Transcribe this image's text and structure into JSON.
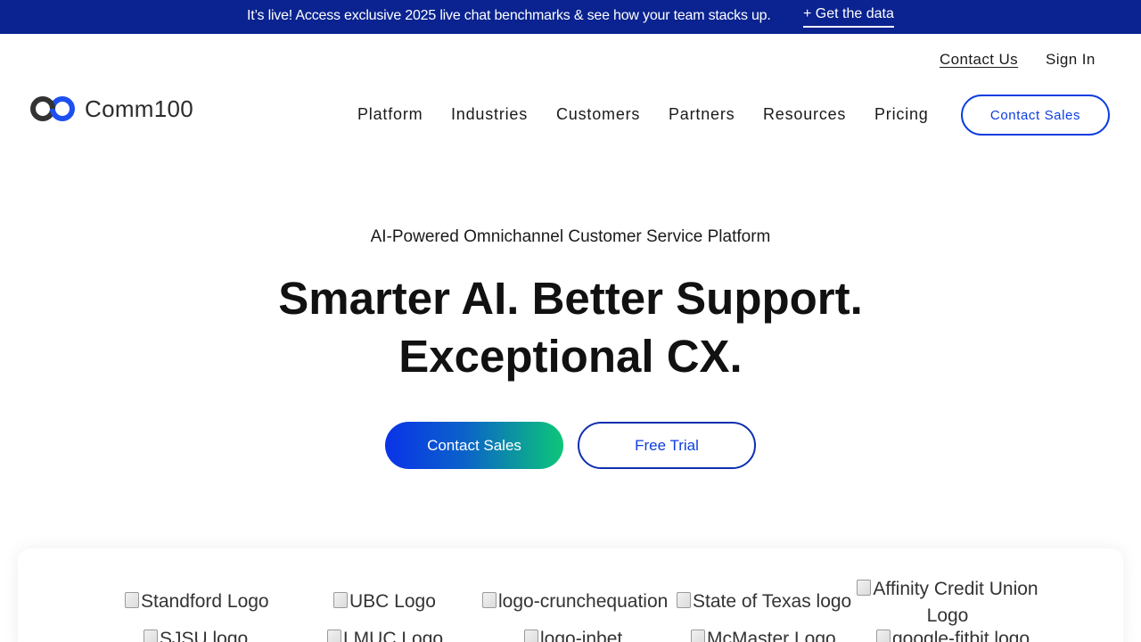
{
  "banner": {
    "message": "It’s live! Access exclusive 2025 live chat benchmarks & see how your team stacks up.",
    "link_label": "+ Get the data"
  },
  "utility_nav": {
    "contact_label": "Contact Us",
    "signin_label": "Sign In"
  },
  "logo": {
    "text": "Comm100"
  },
  "nav": {
    "items": [
      "Platform",
      "Industries",
      "Customers",
      "Partners",
      "Resources",
      "Pricing"
    ],
    "cta_label": "Contact Sales"
  },
  "hero": {
    "eyebrow": "AI-Powered Omnichannel Customer Service Platform",
    "title_line1": "Smarter AI. Better Support.",
    "title_line2": "Exceptional CX.",
    "primary_button": "Contact Sales",
    "secondary_button": "Free Trial"
  },
  "customer_logos": {
    "row1": [
      "Standford Logo",
      "UBC Logo",
      "logo-crunchequation",
      "State of Texas logo",
      "Affinity Credit Union Logo"
    ],
    "row2": [
      "SJSU logo",
      "LMUC Logo",
      "logo-inbet",
      "McMaster Logo",
      "google-fitbit logo"
    ]
  },
  "colors": {
    "banner_bg": "#0a2390",
    "brand_blue": "#0d3de0",
    "gradient_start": "#0a33e8",
    "gradient_end": "#0dc678"
  }
}
